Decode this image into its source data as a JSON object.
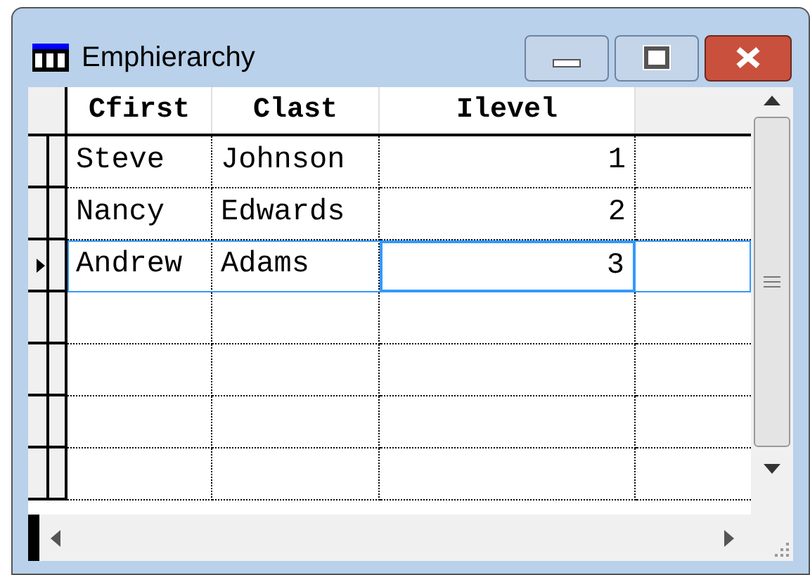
{
  "window": {
    "title": "Emphierarchy"
  },
  "table": {
    "columns": [
      "Cfirst",
      "Clast",
      "Ilevel"
    ],
    "rows": [
      {
        "selected": false,
        "cells": [
          {
            "text": "Steve",
            "focused": false
          },
          {
            "text": "Johnson",
            "focused": false
          },
          {
            "text": "1",
            "focused": false
          }
        ]
      },
      {
        "selected": false,
        "cells": [
          {
            "text": "Nancy",
            "focused": false
          },
          {
            "text": "Edwards",
            "focused": false
          },
          {
            "text": "2",
            "focused": false
          }
        ]
      },
      {
        "selected": true,
        "cells": [
          {
            "text": "Andrew",
            "focused": false
          },
          {
            "text": "Adams",
            "focused": false
          },
          {
            "text": "3",
            "focused": true
          }
        ]
      }
    ]
  }
}
